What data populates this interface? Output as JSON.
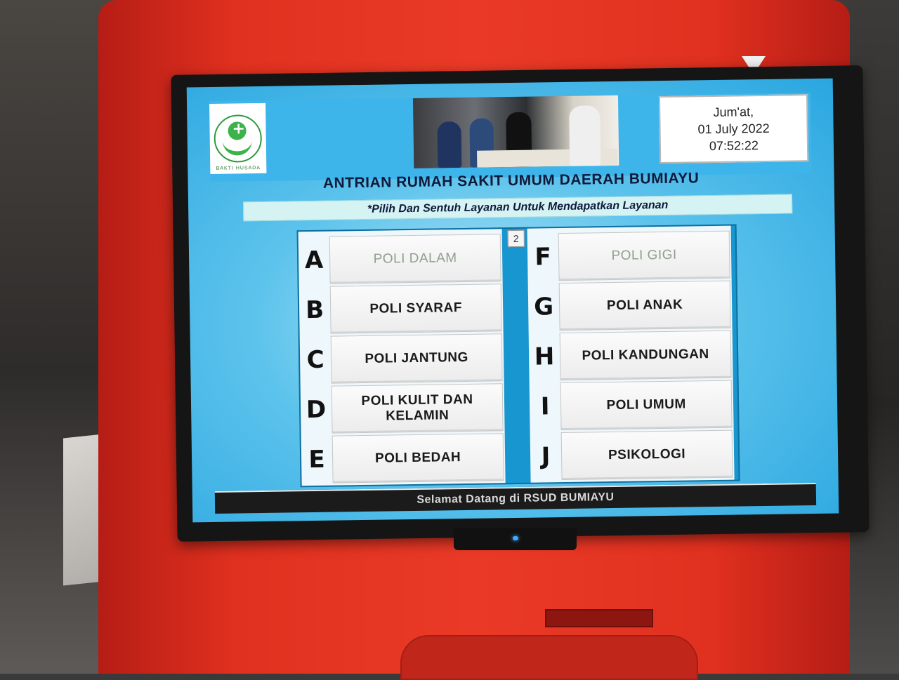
{
  "header": {
    "logo_text": "BAKTI HUSADA",
    "date": {
      "day": "Jum'at,",
      "date": "01 July 2022",
      "time": "07:52:22"
    }
  },
  "title": "ANTRIAN RUMAH SAKIT UMUM DAERAH BUMIAYU",
  "subtitle": "*Pilih Dan Sentuh Layanan Untuk Mendapatkan Layanan",
  "page_number": "2",
  "services_left": [
    {
      "letter": "A",
      "label": "POLI DALAM",
      "state": "dim"
    },
    {
      "letter": "B",
      "label": "POLI SYARAF",
      "state": "active"
    },
    {
      "letter": "C",
      "label": "POLI JANTUNG",
      "state": "active"
    },
    {
      "letter": "D",
      "label": "POLI KULIT DAN KELAMIN",
      "state": "active"
    },
    {
      "letter": "E",
      "label": "POLI BEDAH",
      "state": "active"
    }
  ],
  "services_right": [
    {
      "letter": "F",
      "label": "POLI GIGI",
      "state": "dim"
    },
    {
      "letter": "G",
      "label": "POLI ANAK",
      "state": "active"
    },
    {
      "letter": "H",
      "label": "POLI KANDUNGAN",
      "state": "active"
    },
    {
      "letter": "I",
      "label": "POLI UMUM",
      "state": "active"
    },
    {
      "letter": "J",
      "label": "PSIKOLOGI",
      "state": "active"
    }
  ],
  "footer": "Selamat Datang di RSUD BUMIAYU",
  "colors": {
    "kiosk": "#e0301f",
    "screen_bg": "#2aa6e0",
    "title_text": "#0e1a3c",
    "dim_label": "#8fa08c"
  }
}
